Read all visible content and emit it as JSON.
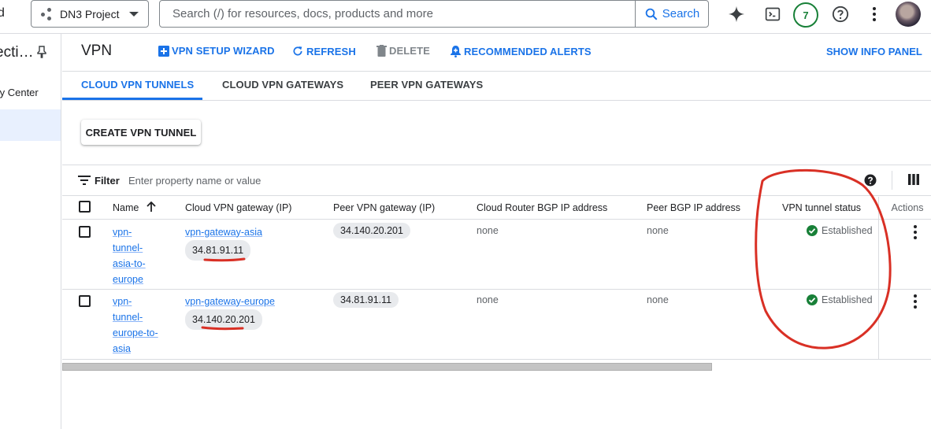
{
  "topbar": {
    "fragment": "d",
    "project": "DN3 Project",
    "search_placeholder": "Search (/) for resources, docs, products and more",
    "search_button": "Search",
    "notifications_count": "7"
  },
  "leftnav": {
    "title": "ecti…",
    "item": "ty Center"
  },
  "page": {
    "title": "VPN",
    "actions": {
      "wizard": "VPN SETUP WIZARD",
      "refresh": "REFRESH",
      "delete": "DELETE",
      "alerts": "RECOMMENDED ALERTS"
    },
    "info_panel": "SHOW INFO PANEL",
    "tabs": [
      "CLOUD VPN TUNNELS",
      "CLOUD VPN GATEWAYS",
      "PEER VPN GATEWAYS"
    ],
    "create_button": "CREATE VPN TUNNEL",
    "filter_label": "Filter",
    "filter_placeholder": "Enter property name or value"
  },
  "table": {
    "columns": [
      "Name",
      "Cloud VPN gateway (IP)",
      "Peer VPN gateway (IP)",
      "Cloud Router BGP IP address",
      "Peer BGP IP address",
      "VPN tunnel status",
      "Actions"
    ],
    "rows": [
      {
        "name_lines": [
          "vpn-",
          "tunnel-",
          "asia-to-",
          "europe"
        ],
        "gateway": "vpn-gateway-asia",
        "gateway_ip": "34.81.91.11",
        "peer_ip": "34.140.20.201",
        "router_bgp": "none",
        "peer_bgp": "none",
        "status": "Established"
      },
      {
        "name_lines": [
          "vpn-",
          "tunnel-",
          "europe-to-",
          "asia"
        ],
        "gateway": "vpn-gateway-europe",
        "gateway_ip": "34.140.20.201",
        "peer_ip": "34.81.91.11",
        "router_bgp": "none",
        "peer_bgp": "none",
        "status": "Established"
      }
    ]
  },
  "colors": {
    "accent": "#1a73e8",
    "success": "#188038",
    "annotation": "#d93025"
  }
}
